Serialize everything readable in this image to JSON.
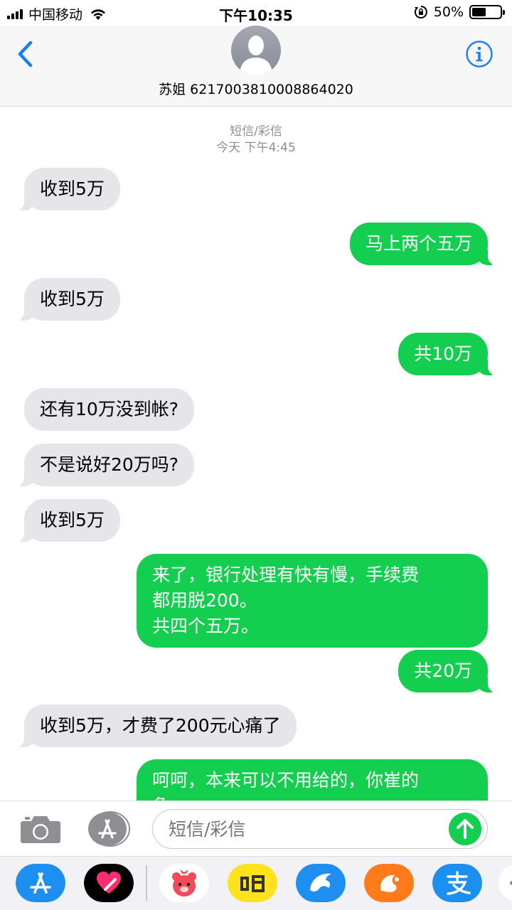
{
  "status_bar": {
    "carrier": "中国移动",
    "time": "下午10:35",
    "battery_percent": "50%",
    "battery_level": 0.5
  },
  "header": {
    "contact_name": "苏姐 6217003810008864020",
    "icons": {
      "back": "chevron-left-icon",
      "avatar": "person-silhouette-icon",
      "info": "info-circle-icon"
    }
  },
  "conversation": {
    "service_label": "短信/彩信",
    "timestamp": "今天 下午4:45",
    "messages": [
      {
        "dir": "in",
        "text": "收到5万"
      },
      {
        "dir": "out",
        "text": "马上两个五万"
      },
      {
        "dir": "in",
        "text": "收到5万"
      },
      {
        "dir": "out",
        "text": "共10万"
      },
      {
        "dir": "in",
        "text": "还有10万没到帐?"
      },
      {
        "dir": "in",
        "text": "不是说好20万吗?"
      },
      {
        "dir": "in",
        "text": "收到5万"
      },
      {
        "dir": "out",
        "text": "来了，银行处理有快有慢，手续费\n都用脱200。\n共四个五万。"
      },
      {
        "dir": "out",
        "text": "共20万"
      },
      {
        "dir": "in",
        "text": "收到5万，才费了200元心痛了"
      },
      {
        "dir": "out",
        "text": "呵呵，本来可以不用给的，你崔的\n急"
      }
    ]
  },
  "input_bar": {
    "placeholder": "短信/彩信",
    "icons": {
      "camera": "camera-icon",
      "apps": "app-store-icon",
      "send": "send-arrow-icon"
    }
  },
  "app_drawer": {
    "apps": [
      "app-store-icon",
      "digital-touch-heart-icon",
      "pink-bear-app-icon",
      "xianyu-app-icon",
      "dolphin-app-icon",
      "uc-squirrel-app-icon",
      "alipay-app-icon",
      "more-apps-icon"
    ]
  },
  "colors": {
    "outgoing_bubble": "#13ce4f",
    "incoming_bubble": "#e5e5ea",
    "ios_blue": "#1a7ef7"
  }
}
